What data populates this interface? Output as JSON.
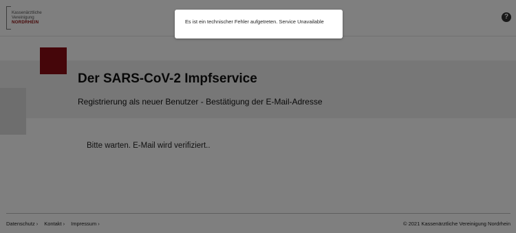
{
  "header": {
    "logo": {
      "line1": "Kassenärztliche",
      "line2": "Vereinigung",
      "line3": "NORDRHEIN"
    },
    "help_icon": "question-circle-icon"
  },
  "main": {
    "title": "Der SARS-CoV-2 Impfservice",
    "subtitle": "Registrierung als neuer Benutzer - Bestätigung der E-Mail-Adresse",
    "status": "Bitte warten. E-Mail wird verifiziert.."
  },
  "footer": {
    "links": [
      {
        "label": "Datenschutz",
        "chevron": "›"
      },
      {
        "label": "Kontakt",
        "chevron": "›"
      },
      {
        "label": "Impressum",
        "chevron": "›"
      }
    ],
    "copyright": "© 2021 Kassenärztliche Vereinigung Nordrhein"
  },
  "toast": {
    "message": "Es ist ein technischer Fehler aufgetreten. Service Unavailable"
  },
  "colors": {
    "brand_red": "#8b0d14",
    "overlay": "rgba(0,0,0,0.5)"
  }
}
